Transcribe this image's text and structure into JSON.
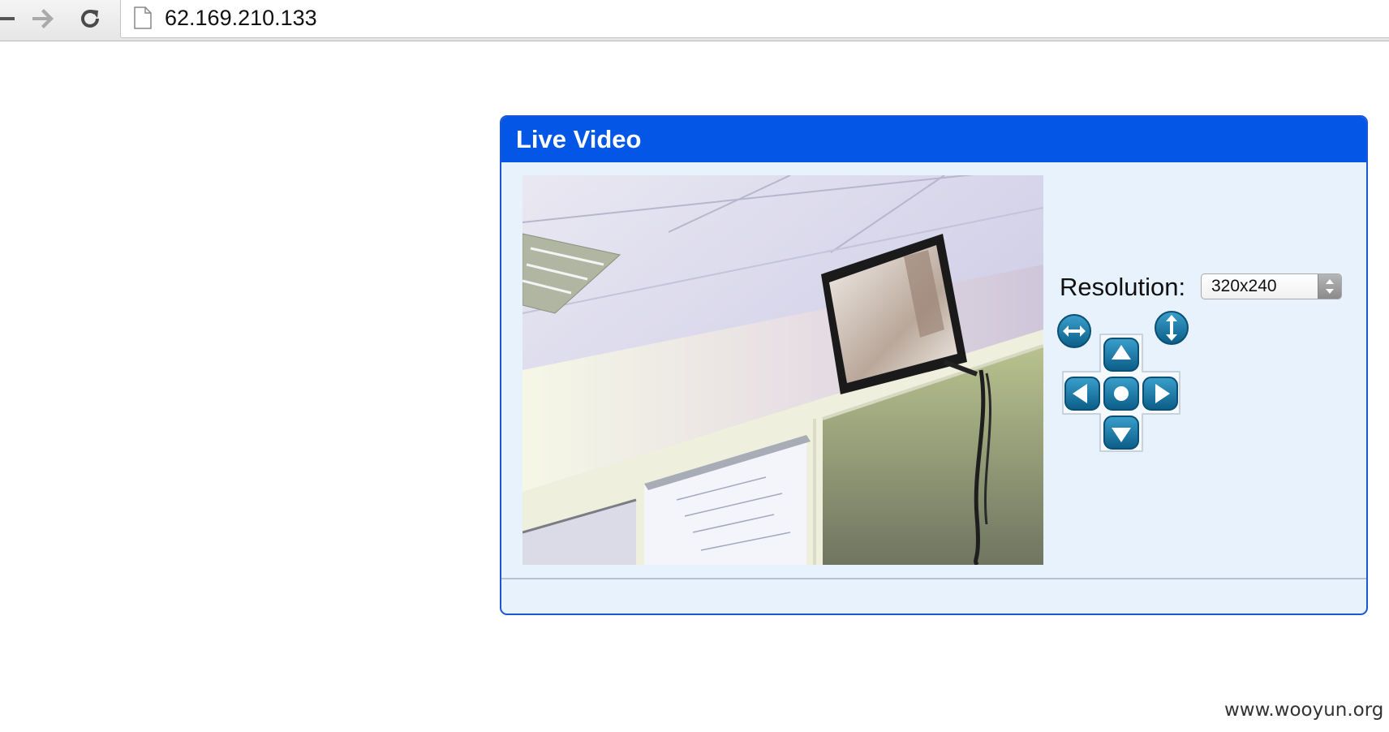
{
  "browser": {
    "url": "62.169.210.133",
    "icons": {
      "back": "back-arrow-icon",
      "forward": "forward-arrow-icon",
      "reload": "reload-icon",
      "page": "page-icon"
    }
  },
  "panel": {
    "title": "Live Video",
    "colors": {
      "header": "#0457e6",
      "border": "#1a56d6",
      "body": "#e7f2fc"
    }
  },
  "controls": {
    "resolution_label": "Resolution:",
    "resolution_value": "320x240",
    "ptz_icons": [
      "pan-scan-icon",
      "tilt-scan-icon",
      "arrow-up-icon",
      "arrow-left-icon",
      "center-icon",
      "arrow-right-icon",
      "arrow-down-icon"
    ],
    "ptz_color": "#1a7fb0"
  },
  "footer": {
    "watermark": "www.wooyun.org"
  }
}
